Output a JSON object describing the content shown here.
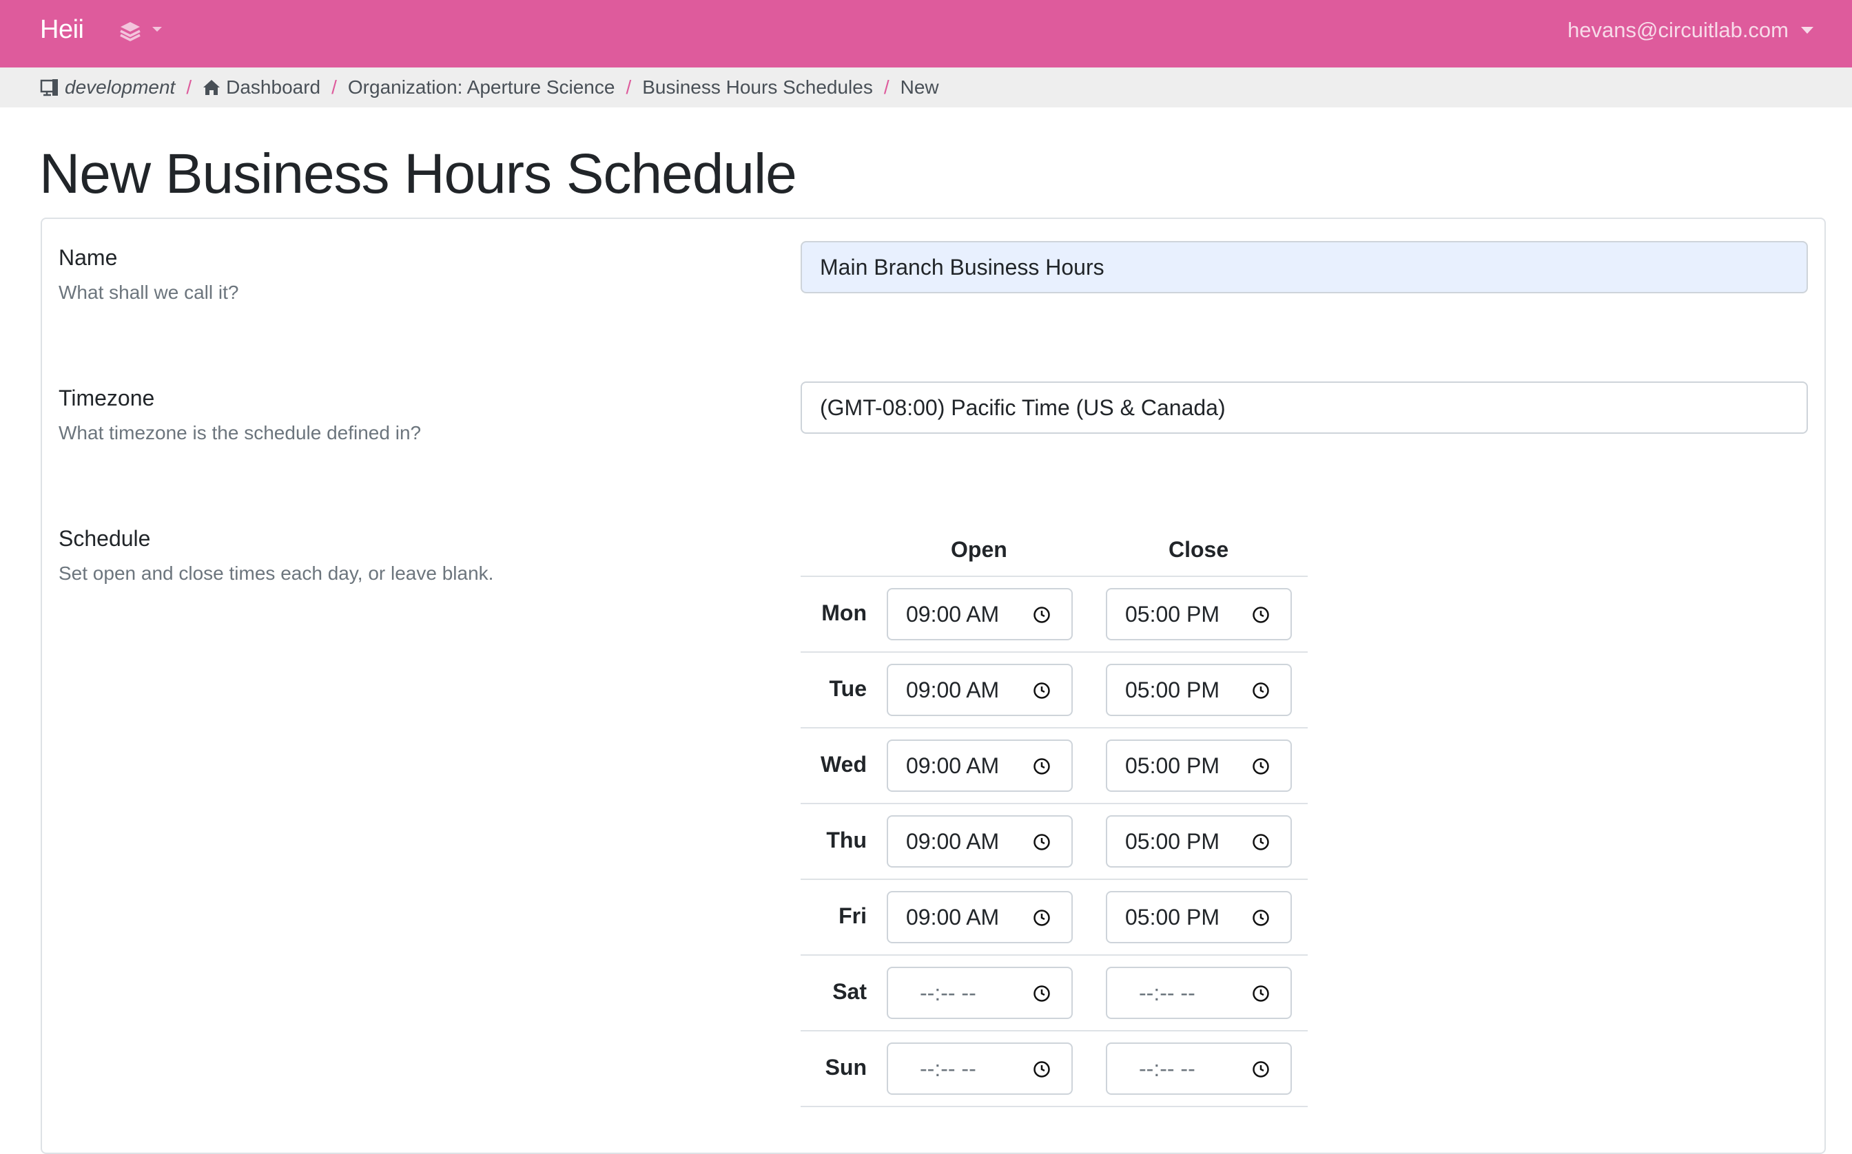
{
  "navbar": {
    "brand": "Heii",
    "menu_icon": "layers-icon",
    "user_email": "hevans@circuitlab.com"
  },
  "breadcrumb": {
    "environment": "development",
    "dashboard": "Dashboard",
    "organization": "Organization: Aperture Science",
    "schedules": "Business Hours Schedules",
    "current": "New",
    "separator": "/"
  },
  "page": {
    "title": "New Business Hours Schedule"
  },
  "form": {
    "name": {
      "label": "Name",
      "hint": "What shall we call it?",
      "value": "Main Branch Business Hours"
    },
    "timezone": {
      "label": "Timezone",
      "hint": "What timezone is the schedule defined in?",
      "value": "(GMT-08:00) Pacific Time (US & Canada)"
    },
    "schedule": {
      "label": "Schedule",
      "hint": "Set open and close times each day, or leave blank.",
      "open_header": "Open",
      "close_header": "Close",
      "days": [
        {
          "day": "Mon",
          "open": "09:00 AM",
          "close": "05:00 PM"
        },
        {
          "day": "Tue",
          "open": "09:00 AM",
          "close": "05:00 PM"
        },
        {
          "day": "Wed",
          "open": "09:00 AM",
          "close": "05:00 PM"
        },
        {
          "day": "Thu",
          "open": "09:00 AM",
          "close": "05:00 PM"
        },
        {
          "day": "Fri",
          "open": "09:00 AM",
          "close": "05:00 PM"
        },
        {
          "day": "Sat",
          "open": "--:-- --",
          "close": "--:-- --"
        },
        {
          "day": "Sun",
          "open": "--:-- --",
          "close": "--:-- --"
        }
      ]
    }
  },
  "colors": {
    "navbar": "#de5b9c",
    "breadcrumb_bg": "#eeeeee",
    "autofill_bg": "#e8f0fe"
  }
}
